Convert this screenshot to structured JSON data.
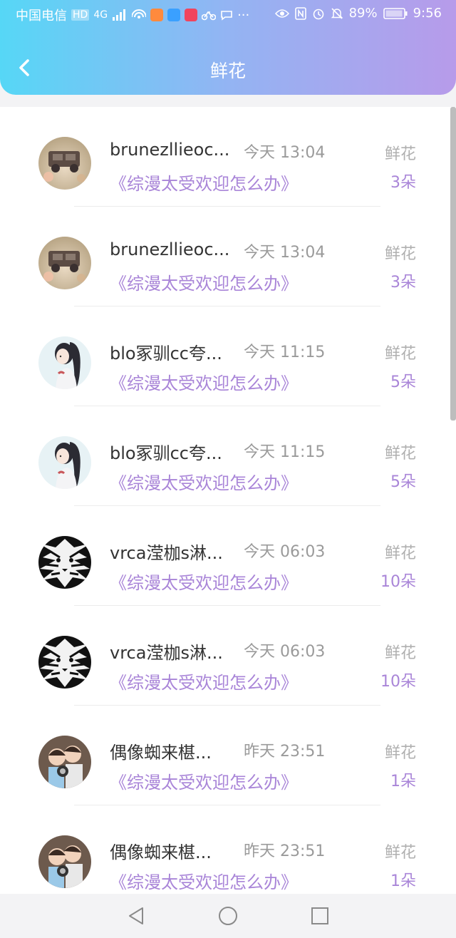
{
  "status_bar": {
    "carrier": "中国电信",
    "hd": "HD",
    "net": "4G",
    "battery": "89%",
    "time": "9:56"
  },
  "header": {
    "title": "鲜花"
  },
  "gifts": [
    {
      "user": "brunezllieoc...",
      "time": "今天 13:04",
      "book": "《综漫太受欢迎怎么办》",
      "type": "鲜花",
      "count": "3朵",
      "avatar": "toy-car-avatar"
    },
    {
      "user": "brunezllieoc...",
      "time": "今天 13:04",
      "book": "《综漫太受欢迎怎么办》",
      "type": "鲜花",
      "count": "3朵",
      "avatar": "toy-car-avatar"
    },
    {
      "user": "blo冢驯cc夸...",
      "time": "今天 11:15",
      "book": "《综漫太受欢迎怎么办》",
      "type": "鲜花",
      "count": "5朵",
      "avatar": "anime-girl-avatar"
    },
    {
      "user": "blo冢驯cc夸...",
      "time": "今天 11:15",
      "book": "《综漫太受欢迎怎么办》",
      "type": "鲜花",
      "count": "5朵",
      "avatar": "anime-girl-avatar"
    },
    {
      "user": "vrca滢枷s淋...",
      "time": "今天 06:03",
      "book": "《综漫太受欢迎怎么办》",
      "type": "鲜花",
      "count": "10朵",
      "avatar": "tiger-avatar"
    },
    {
      "user": "vrca滢枷s淋...",
      "time": "今天 06:03",
      "book": "《综漫太受欢迎怎么办》",
      "type": "鲜花",
      "count": "10朵",
      "avatar": "tiger-avatar"
    },
    {
      "user": "偶像蜘来椹...",
      "time": "昨天 23:51",
      "book": "《综漫太受欢迎怎么办》",
      "type": "鲜花",
      "count": "1朵",
      "avatar": "kids-avatar"
    },
    {
      "user": "偶像蜘来椹...",
      "time": "昨天 23:51",
      "book": "《综漫太受欢迎怎么办》",
      "type": "鲜花",
      "count": "1朵",
      "avatar": "kids-avatar"
    }
  ]
}
